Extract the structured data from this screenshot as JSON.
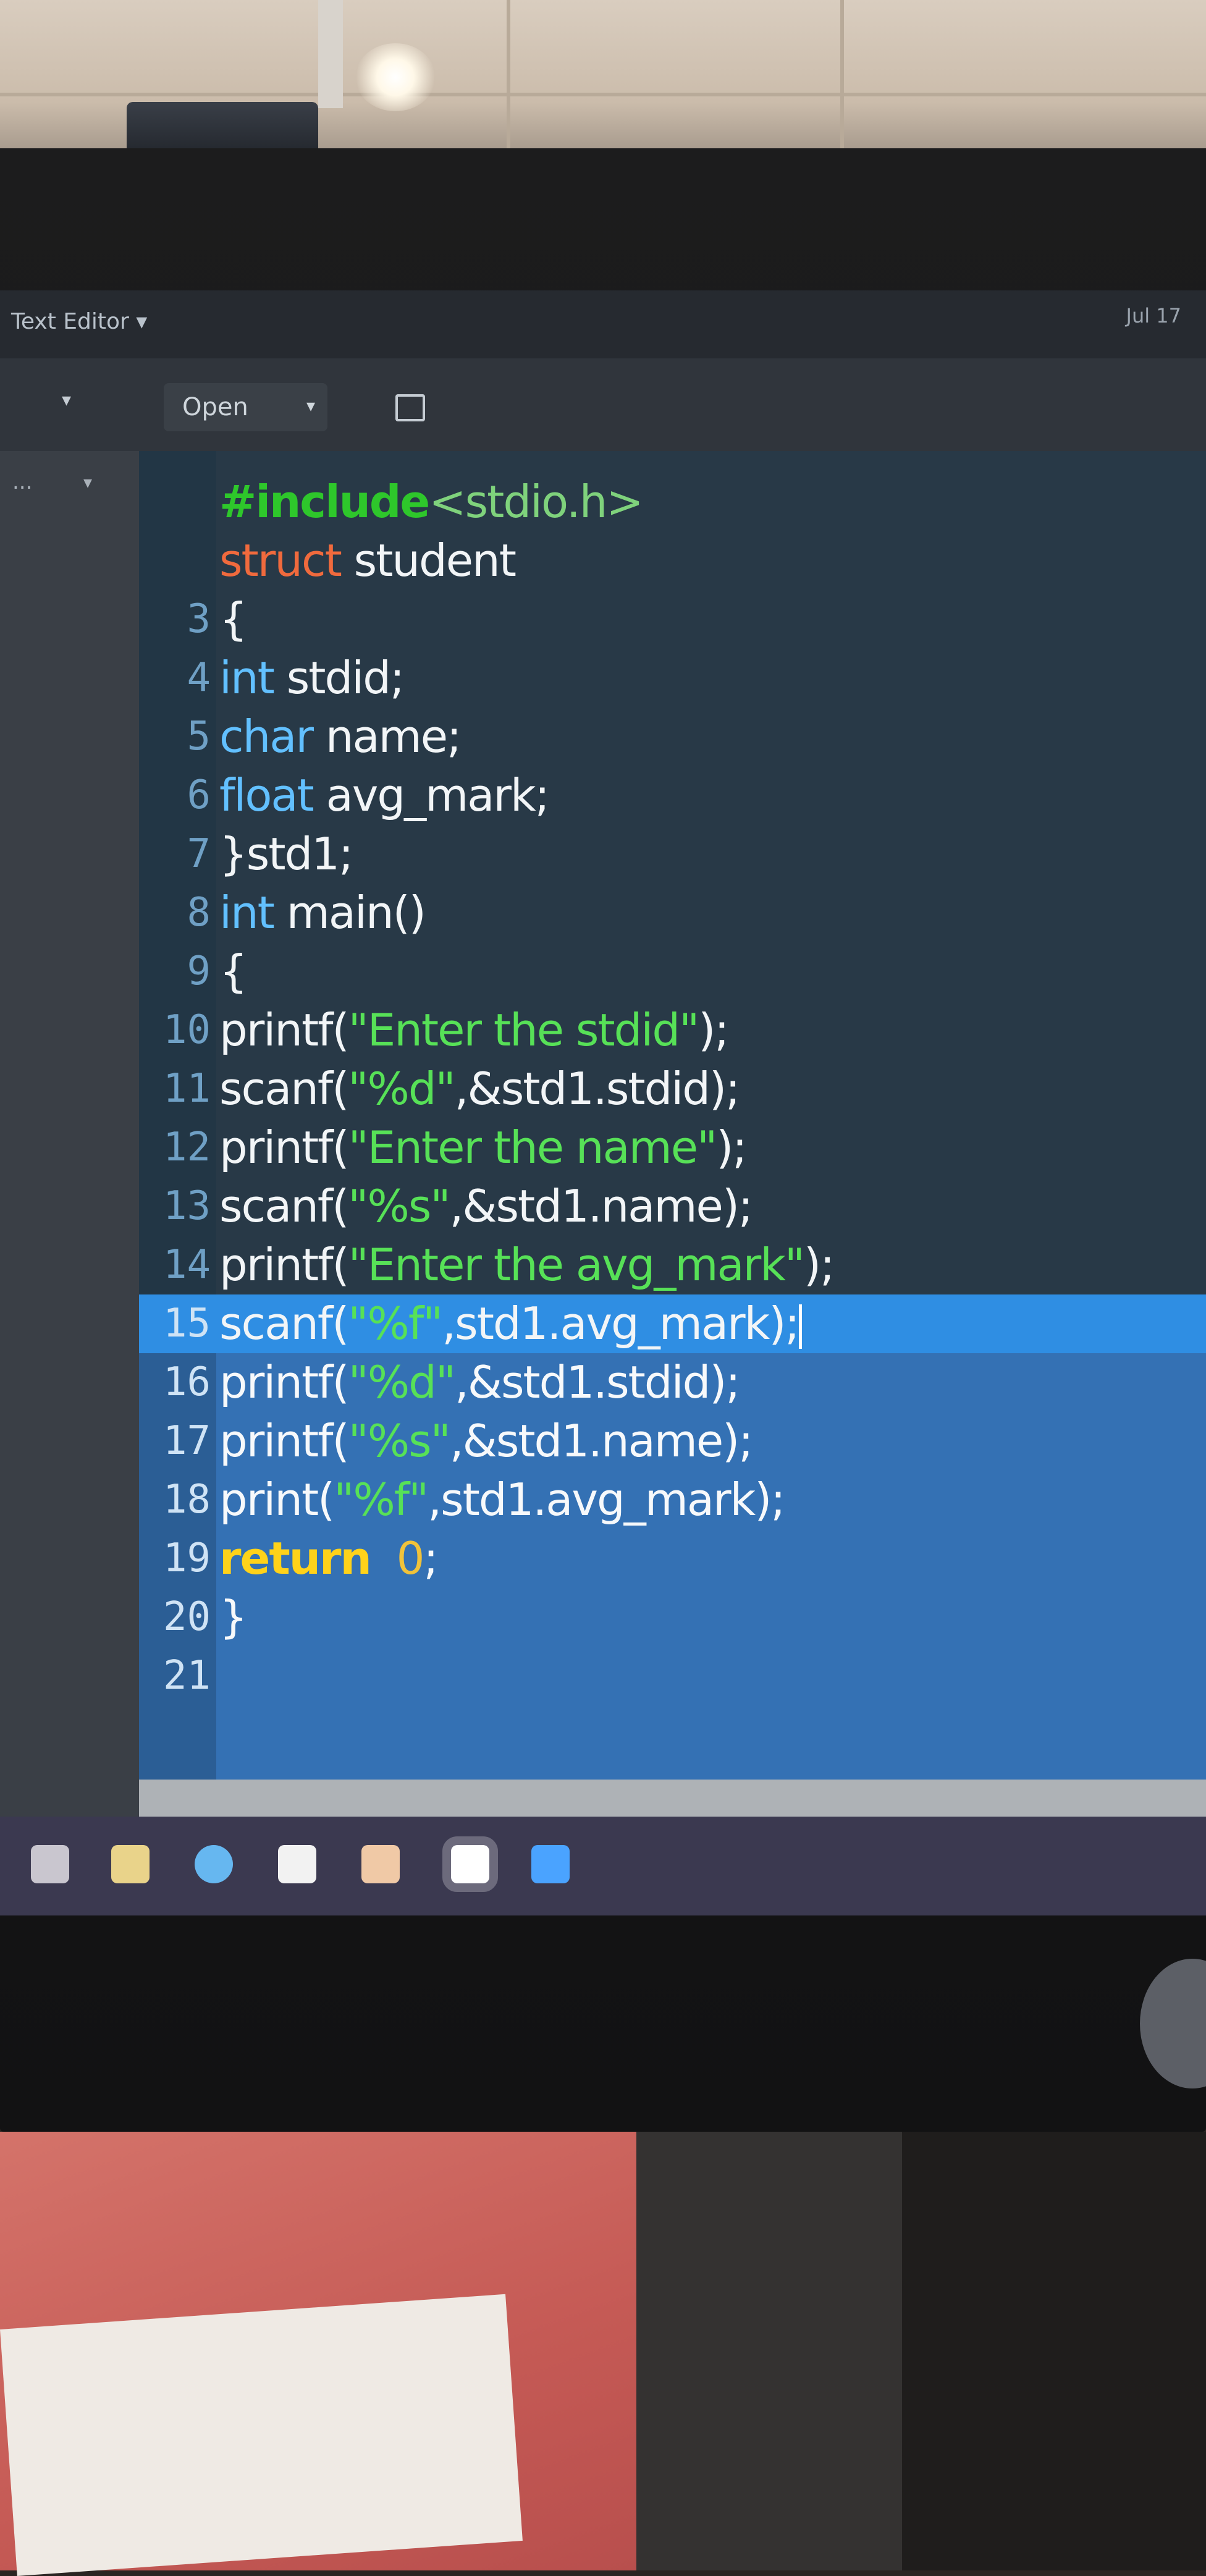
{
  "window": {
    "app_title": "Text Editor ▾",
    "clock": "Jul 17"
  },
  "toolbar": {
    "open_label": "Open",
    "open_chevron": "▾",
    "side_dots": "...",
    "side_chevron": "▾",
    "save_icon": "save-icon"
  },
  "editor": {
    "active_line": 15,
    "lines": [
      {
        "n": "",
        "tokens": [
          {
            "t": "#include",
            "c": "pre"
          },
          {
            "t": "<stdio.h>",
            "c": "inc"
          }
        ]
      },
      {
        "n": "",
        "tokens": [
          {
            "t": "struct",
            "c": "kw"
          },
          {
            "t": " student",
            "c": ""
          }
        ]
      },
      {
        "n": "3",
        "tokens": [
          {
            "t": "{",
            "c": ""
          }
        ]
      },
      {
        "n": "4",
        "tokens": [
          {
            "t": "int",
            "c": "type"
          },
          {
            "t": " stdid;",
            "c": ""
          }
        ]
      },
      {
        "n": "5",
        "tokens": [
          {
            "t": "char",
            "c": "type"
          },
          {
            "t": " name;",
            "c": ""
          }
        ]
      },
      {
        "n": "6",
        "tokens": [
          {
            "t": "float",
            "c": "type"
          },
          {
            "t": " avg_mark;",
            "c": ""
          }
        ]
      },
      {
        "n": "7",
        "tokens": [
          {
            "t": "}std1;",
            "c": ""
          }
        ]
      },
      {
        "n": "8",
        "tokens": [
          {
            "t": "int",
            "c": "type"
          },
          {
            "t": " main()",
            "c": ""
          }
        ]
      },
      {
        "n": "9",
        "tokens": [
          {
            "t": "{",
            "c": ""
          }
        ]
      },
      {
        "n": "10",
        "tokens": [
          {
            "t": "printf(",
            "c": ""
          },
          {
            "t": "\"Enter the stdid\"",
            "c": "str"
          },
          {
            "t": ");",
            "c": ""
          }
        ]
      },
      {
        "n": "11",
        "tokens": [
          {
            "t": "scanf(",
            "c": ""
          },
          {
            "t": "\"%d\"",
            "c": "str"
          },
          {
            "t": ",&std1.stdid);",
            "c": ""
          }
        ]
      },
      {
        "n": "12",
        "tokens": [
          {
            "t": "printf(",
            "c": ""
          },
          {
            "t": "\"Enter the name\"",
            "c": "str"
          },
          {
            "t": ");",
            "c": ""
          }
        ]
      },
      {
        "n": "13",
        "tokens": [
          {
            "t": "scanf(",
            "c": ""
          },
          {
            "t": "\"%s\"",
            "c": "str"
          },
          {
            "t": ",&std1.name);",
            "c": ""
          }
        ]
      },
      {
        "n": "14",
        "tokens": [
          {
            "t": "printf(",
            "c": ""
          },
          {
            "t": "\"Enter the avg_mark\"",
            "c": "str"
          },
          {
            "t": ");",
            "c": ""
          }
        ]
      },
      {
        "n": "15",
        "tokens": [
          {
            "t": "scanf(",
            "c": ""
          },
          {
            "t": "\"%f\"",
            "c": "str"
          },
          {
            "t": ",std1.avg_mark);",
            "c": ""
          }
        ]
      },
      {
        "n": "16",
        "tokens": [
          {
            "t": "printf(",
            "c": ""
          },
          {
            "t": "\"%d\"",
            "c": "str"
          },
          {
            "t": ",&std1.stdid);",
            "c": ""
          }
        ]
      },
      {
        "n": "17",
        "tokens": [
          {
            "t": "printf(",
            "c": ""
          },
          {
            "t": "\"%s\"",
            "c": "str"
          },
          {
            "t": ",&std1.name);",
            "c": ""
          }
        ]
      },
      {
        "n": "18",
        "tokens": [
          {
            "t": "print(",
            "c": ""
          },
          {
            "t": "\"%f\"",
            "c": "str"
          },
          {
            "t": ",std1.avg_mark);",
            "c": ""
          }
        ]
      },
      {
        "n": "19",
        "tokens": [
          {
            "t": "return",
            "c": "ret"
          },
          {
            "t": "  ",
            "c": ""
          },
          {
            "t": "0",
            "c": "num"
          },
          {
            "t": ";",
            "c": ""
          }
        ]
      },
      {
        "n": "20",
        "tokens": [
          {
            "t": "}",
            "c": ""
          }
        ]
      },
      {
        "n": "21",
        "tokens": []
      }
    ]
  },
  "dock": {
    "items": [
      {
        "icon": "terminal-icon",
        "color": "#c9c6cf"
      },
      {
        "icon": "files-icon",
        "color": "#e9d38a"
      },
      {
        "icon": "browser-icon",
        "color": "#66b7f0"
      },
      {
        "icon": "document-icon",
        "color": "#f2f2f2"
      },
      {
        "icon": "store-icon",
        "color": "#f0c9a6"
      },
      {
        "icon": "text-editor-icon",
        "color": "#ffffff"
      },
      {
        "icon": "vscode-icon",
        "color": "#4aa3ff"
      }
    ]
  },
  "colors": {
    "active_line": "#2f8ee3",
    "editor_bg": "#283947",
    "string": "#57e157",
    "keyword": "#f06a3d",
    "type": "#62c0ff"
  }
}
